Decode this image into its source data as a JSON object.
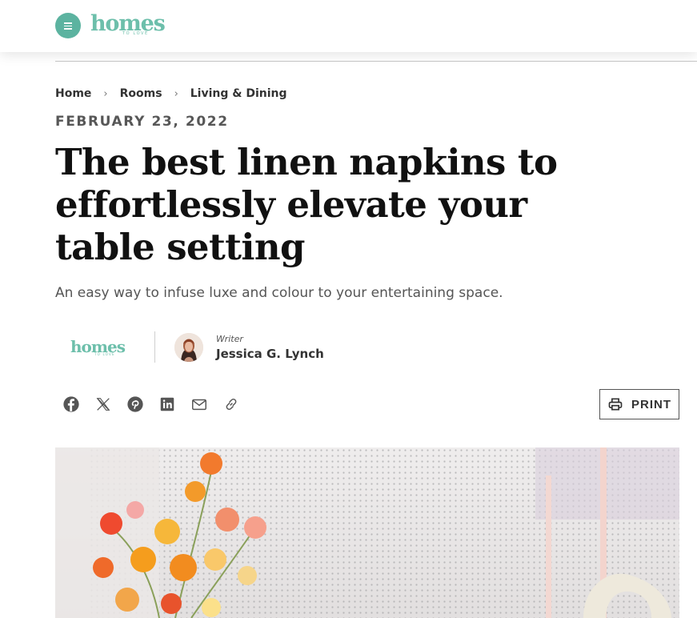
{
  "header": {
    "logo_text": "homes",
    "logo_tagline": "TO LOVE"
  },
  "breadcrumb": {
    "items": [
      "Home",
      "Rooms",
      "Living & Dining"
    ]
  },
  "article": {
    "date": "FEBRUARY 23, 2022",
    "title": "The best linen napkins to effortlessly elevate your table setting",
    "subtitle": "An easy way to infuse luxe and colour to your entertaining space."
  },
  "author": {
    "brand_logo_text": "homes",
    "brand_logo_tagline": "TO LOVE",
    "role": "Writer",
    "name": "Jessica G. Lynch"
  },
  "share": {
    "icons": [
      "facebook-icon",
      "x-icon",
      "pinterest-icon",
      "linkedin-icon",
      "email-icon",
      "link-icon"
    ],
    "print_label": "PRINT"
  },
  "colors": {
    "brand": "#6dbfab",
    "menu_button": "#5cb3a0",
    "text": "#1a1a1a"
  }
}
